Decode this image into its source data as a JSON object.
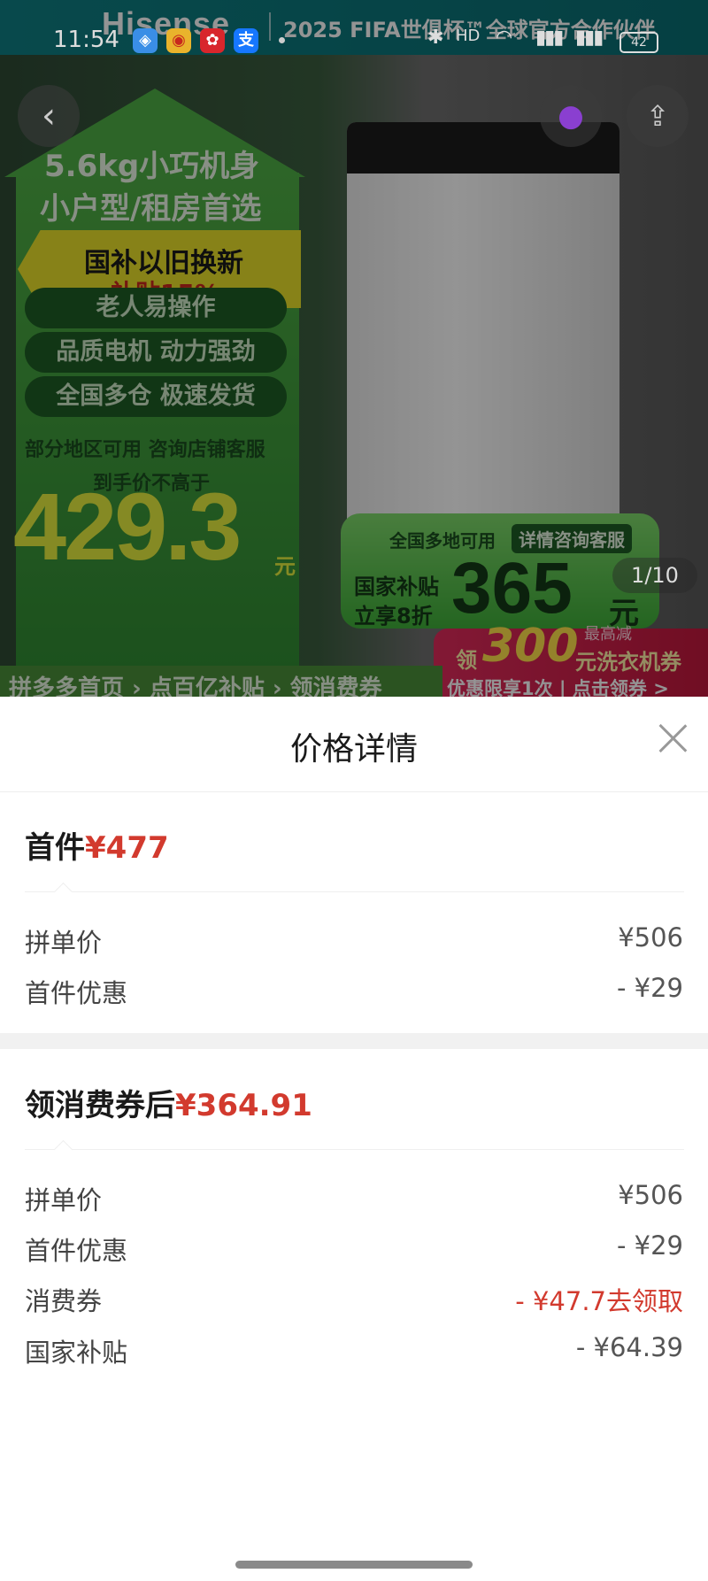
{
  "status_bar": {
    "time": "11:54",
    "apps": [
      "maps-app-icon",
      "weibo-app-icon",
      "pinduoduo-app-icon",
      "alipay-app-icon"
    ],
    "battery": "42"
  },
  "banner": {
    "brand": "Hisense",
    "slogan": "2025 FIFA世俱杯™全球官方合作伙伴"
  },
  "product_image": {
    "headline_1": "5.6kg小巧机身",
    "headline_2": "小户型/租房首选",
    "tag_1": "国补以旧换新",
    "tag_2": "补贴15%",
    "features": [
      "老人易操作",
      "品质电机 动力强劲",
      "全国多仓 极速发货"
    ],
    "note_1": "部分地区可用 咨询店铺客服",
    "note_2": "到手价不高于",
    "price": "429.3",
    "price_unit": "元",
    "promo_top": "全国多地可用",
    "promo_btn": "详情咨询客服",
    "promo_line1": "国家补贴",
    "promo_line2": "立享8折",
    "promo_price": "365",
    "promo_unit": "元",
    "coupon_prefix": "领",
    "coupon_amount": "300",
    "coupon_text": "元洗衣机券",
    "coupon_max": "最高减",
    "coupon_sub": "优惠限享1次 | 点击领券 >",
    "strip": "拼多多首页 › 点百亿补贴 › 领消费券",
    "counter": "1/10"
  },
  "sheet": {
    "title": "价格详情",
    "section1": {
      "label": "首件",
      "price": "¥477",
      "rows": [
        {
          "label": "拼单价",
          "value": "¥506"
        },
        {
          "label": "首件优惠",
          "value": "- ¥29"
        }
      ]
    },
    "section2": {
      "label": "领消费券后",
      "price": "¥364.91",
      "rows": [
        {
          "label": "拼单价",
          "value": "¥506"
        },
        {
          "label": "首件优惠",
          "value": "- ¥29"
        },
        {
          "label": "消费券",
          "value": "- ¥47.7去领取",
          "highlight": true
        },
        {
          "label": "国家补贴",
          "value": "- ¥64.39"
        }
      ]
    }
  },
  "colors": {
    "accent_red": "#d23a2e",
    "brand_teal": "#0e7f83",
    "poster_green": "#4fae45"
  }
}
